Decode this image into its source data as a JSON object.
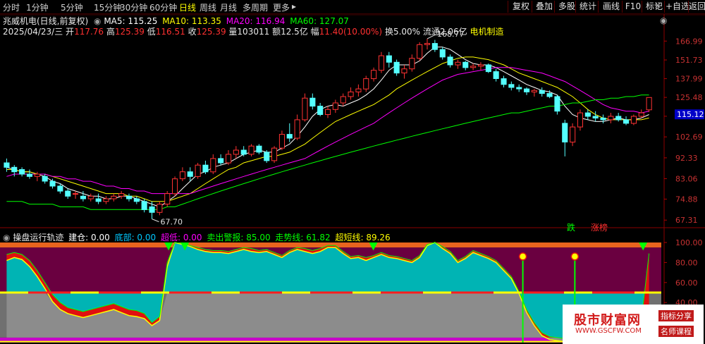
{
  "toolbar": {
    "periods": [
      "分时",
      "1分钟",
      "5分钟",
      "15分钟",
      "30分钟",
      "60分钟",
      "日线",
      "周线",
      "月线",
      "多周期",
      "更多"
    ],
    "active": "日线",
    "more_arrow": "▸",
    "buttons": [
      "复权",
      "叠加",
      "多股",
      "统计",
      "画线",
      "F10",
      "标记",
      "+自选",
      "返回"
    ],
    "close_icon": "close-icon"
  },
  "header": {
    "title": "兆威机电(日线,前复权)",
    "ma": [
      {
        "label": "MA5: 115.25",
        "color": "#ffffff"
      },
      {
        "label": "MA10: 113.35",
        "color": "#ffff00"
      },
      {
        "label": "MA20: 116.94",
        "color": "#ff00ff"
      },
      {
        "label": "MA60: 127.07",
        "color": "#00ff00"
      }
    ],
    "ohlc": {
      "date": "2025/04/23/三",
      "open_label": "开",
      "open": "117.76",
      "high_label": "高",
      "high": "125.39",
      "low_label": "低",
      "low": "116.51",
      "close_label": "收",
      "close": "125.39",
      "vol": "量103011",
      "amt": "额12.5亿",
      "chg_label": "幅",
      "chg": "11.40(10.00%)",
      "turn": "换5.00%",
      "float": "流通2.06亿",
      "industry": "电机制造"
    },
    "side_icon": "gear-icon"
  },
  "price_axis": {
    "ticks": [
      "166.99",
      "151.73",
      "137.99",
      "125.48",
      "114.02",
      "102.69",
      "92.33",
      "83.06",
      "74.88",
      "67.31"
    ],
    "current": "115.12",
    "annotations": {
      "high": "168.77",
      "low": "67.70"
    }
  },
  "chart_data": {
    "type": "candlestick",
    "ylim": [
      65,
      172
    ],
    "candles": [
      [
        90,
        92,
        86,
        88
      ],
      [
        88,
        89,
        84,
        86
      ],
      [
        87,
        88,
        84,
        85
      ],
      [
        85,
        87,
        83,
        84
      ],
      [
        84,
        86,
        82,
        85
      ],
      [
        84,
        85,
        81,
        82
      ],
      [
        82,
        83,
        79,
        80
      ],
      [
        80,
        81,
        77,
        78
      ],
      [
        78,
        79,
        75,
        76
      ],
      [
        77,
        78,
        75,
        77
      ],
      [
        76,
        78,
        74,
        75
      ],
      [
        75,
        77,
        74,
        76
      ],
      [
        75,
        77,
        73,
        74
      ],
      [
        74,
        76,
        73,
        75
      ],
      [
        75,
        77,
        74,
        76
      ],
      [
        76,
        78,
        75,
        77
      ],
      [
        76,
        77,
        74,
        75
      ],
      [
        75,
        76,
        73,
        74
      ],
      [
        74,
        75,
        70,
        71
      ],
      [
        72,
        74,
        67.7,
        70
      ],
      [
        70,
        74,
        69,
        73
      ],
      [
        73,
        78,
        72,
        77
      ],
      [
        77,
        84,
        76,
        83
      ],
      [
        83,
        88,
        82,
        86
      ],
      [
        86,
        88,
        82,
        84
      ],
      [
        84,
        90,
        83,
        89
      ],
      [
        89,
        91,
        85,
        86
      ],
      [
        86,
        94,
        85,
        92
      ],
      [
        92,
        94,
        89,
        90
      ],
      [
        90,
        96,
        89,
        94
      ],
      [
        94,
        98,
        92,
        96
      ],
      [
        96,
        98,
        93,
        94
      ],
      [
        94,
        99,
        93,
        98
      ],
      [
        98,
        99,
        94,
        95
      ],
      [
        95,
        96,
        90,
        91
      ],
      [
        91,
        98,
        90,
        97
      ],
      [
        97,
        106,
        96,
        104
      ],
      [
        104,
        110,
        100,
        102
      ],
      [
        102,
        115,
        101,
        112
      ],
      [
        112,
        128,
        111,
        125
      ],
      [
        125,
        128,
        118,
        120
      ],
      [
        120,
        122,
        114,
        115
      ],
      [
        115,
        120,
        113,
        118
      ],
      [
        118,
        124,
        116,
        122
      ],
      [
        122,
        128,
        120,
        126
      ],
      [
        126,
        132,
        124,
        129
      ],
      [
        129,
        134,
        126,
        131
      ],
      [
        131,
        140,
        129,
        138
      ],
      [
        138,
        146,
        136,
        144
      ],
      [
        144,
        158,
        142,
        155
      ],
      [
        155,
        158,
        146,
        150
      ],
      [
        150,
        152,
        140,
        142
      ],
      [
        142,
        148,
        138,
        145
      ],
      [
        145,
        156,
        143,
        153
      ],
      [
        153,
        166,
        151,
        164
      ],
      [
        164,
        169,
        160,
        165
      ],
      [
        165,
        168,
        158,
        160
      ],
      [
        160,
        162,
        152,
        154
      ],
      [
        154,
        156,
        146,
        148
      ],
      [
        148,
        152,
        145,
        150
      ],
      [
        150,
        151,
        144,
        146
      ],
      [
        146,
        149,
        144,
        147
      ],
      [
        147,
        150,
        144,
        148
      ],
      [
        148,
        149,
        142,
        143
      ],
      [
        143,
        145,
        136,
        138
      ],
      [
        138,
        140,
        132,
        134
      ],
      [
        134,
        136,
        130,
        132
      ],
      [
        132,
        134,
        129,
        131
      ],
      [
        131,
        132,
        127,
        129
      ],
      [
        129,
        131,
        126,
        130
      ],
      [
        130,
        132,
        126,
        128
      ],
      [
        128,
        130,
        125,
        126
      ],
      [
        126,
        127,
        115,
        117
      ],
      [
        110,
        112,
        93,
        100
      ],
      [
        100,
        110,
        98,
        108
      ],
      [
        108,
        118,
        106,
        116
      ],
      [
        116,
        118,
        112,
        114
      ],
      [
        114,
        117,
        111,
        113
      ],
      [
        113,
        115,
        110,
        112
      ],
      [
        112,
        116,
        110,
        114
      ],
      [
        114,
        116,
        111,
        112
      ],
      [
        112,
        114,
        109,
        110
      ],
      [
        110,
        115,
        109,
        114
      ],
      [
        114,
        118,
        113,
        116
      ],
      [
        117.76,
        125.39,
        116.51,
        125.39
      ]
    ],
    "ma_lines": [
      {
        "name": "MA5",
        "color": "#ffffff",
        "values": [
          88,
          87,
          86,
          86,
          85,
          84,
          82,
          81,
          79,
          78,
          77,
          76,
          76,
          75,
          75,
          76,
          76,
          75,
          74,
          73,
          72,
          74,
          76,
          79,
          82,
          85,
          86,
          88,
          89,
          90,
          92,
          94,
          95,
          96,
          95,
          95,
          97,
          99,
          103,
          108,
          114,
          118,
          120,
          121,
          120,
          122,
          124,
          127,
          131,
          137,
          144,
          148,
          148,
          148,
          151,
          157,
          162,
          162,
          160,
          156,
          152,
          149,
          148,
          148,
          146,
          143,
          140,
          137,
          134,
          132,
          130,
          129,
          127,
          120,
          115,
          113,
          112,
          111,
          111,
          112,
          113,
          112,
          112,
          113,
          115
        ]
      },
      {
        "name": "MA10",
        "color": "#ffff00",
        "values": [
          87,
          87,
          86,
          86,
          85,
          85,
          84,
          83,
          82,
          81,
          80,
          79,
          78,
          77,
          77,
          77,
          76,
          76,
          75,
          74,
          74,
          74,
          75,
          76,
          77,
          79,
          81,
          83,
          85,
          87,
          88,
          90,
          91,
          92,
          93,
          93,
          94,
          95,
          97,
          99,
          102,
          105,
          108,
          111,
          113,
          115,
          117,
          119,
          121,
          124,
          127,
          131,
          134,
          137,
          140,
          143,
          146,
          149,
          151,
          153,
          154,
          154,
          153,
          152,
          150,
          148,
          145,
          142,
          140,
          138,
          136,
          134,
          132,
          129,
          126,
          122,
          118,
          115,
          113,
          112,
          112,
          112,
          112,
          112,
          113
        ]
      },
      {
        "name": "MA20",
        "color": "#ff00ff",
        "values": [
          84,
          85,
          85,
          85,
          85,
          85,
          84,
          84,
          83,
          83,
          82,
          82,
          81,
          80,
          80,
          79,
          79,
          78,
          78,
          77,
          77,
          77,
          77,
          77,
          77,
          78,
          79,
          80,
          81,
          82,
          83,
          84,
          85,
          86,
          87,
          88,
          89,
          90,
          91,
          92,
          94,
          96,
          98,
          100,
          102,
          104,
          106,
          108,
          110,
          113,
          116,
          119,
          122,
          125,
          128,
          131,
          134,
          137,
          139,
          141,
          142,
          143,
          144,
          145,
          146,
          146,
          146,
          145,
          144,
          143,
          142,
          140,
          138,
          136,
          133,
          130,
          127,
          124,
          121,
          119,
          118,
          117,
          117,
          116,
          117
        ]
      },
      {
        "name": "MA60",
        "color": "#00ff00",
        "values": [
          74,
          74,
          74,
          73,
          73,
          73,
          73,
          72,
          72,
          72,
          72,
          71,
          71,
          71,
          71,
          71,
          71,
          71,
          71,
          71,
          71,
          72,
          72,
          73,
          74,
          75,
          76,
          77,
          78,
          79,
          80,
          81,
          82,
          83,
          84,
          85,
          86,
          87,
          88,
          89,
          90,
          91,
          92,
          93,
          94,
          95,
          96,
          97,
          98,
          99,
          100,
          101,
          102,
          103,
          104,
          105,
          106,
          107,
          108,
          109,
          110,
          111,
          112,
          113,
          114,
          115,
          116,
          116,
          117,
          118,
          119,
          120,
          120,
          121,
          122,
          122,
          123,
          124,
          124,
          125,
          125,
          126,
          126,
          127,
          127
        ]
      }
    ],
    "labels": [
      {
        "text": "跌",
        "color": "#00ff00"
      },
      {
        "text": "涨榜",
        "color": "#ff3030"
      }
    ]
  },
  "sub": {
    "title": "操盘运行轨迹",
    "items": [
      {
        "label": "建仓: 0.00",
        "color": "#ffffff"
      },
      {
        "label": "底部: 0.00",
        "color": "#00c8ff"
      },
      {
        "label": "超低: 0.00",
        "color": "#ff00ff"
      },
      {
        "label": "卖出警报: 85.00",
        "color": "#00ff00"
      },
      {
        "label": "走势线: 61.82",
        "color": "#00ff00"
      },
      {
        "label": "超短线: 89.26",
        "color": "#ffff00"
      }
    ],
    "ticks": [
      "100.00",
      "80.00",
      "60.00",
      "40.00",
      "20.00"
    ],
    "ylim": [
      0,
      100
    ],
    "trend": [
      82,
      85,
      83,
      76,
      66,
      54,
      41,
      33,
      29,
      27,
      25,
      27,
      29,
      31,
      33,
      30,
      27,
      26,
      24,
      17,
      22,
      76,
      100,
      98,
      96,
      93,
      91,
      90,
      90,
      89,
      91,
      93,
      91,
      90,
      91,
      88,
      85,
      90,
      93,
      91,
      89,
      91,
      95,
      95,
      89,
      84,
      85,
      82,
      85,
      88,
      85,
      84,
      82,
      80,
      85,
      97,
      100,
      94,
      89,
      80,
      84,
      90,
      87,
      84,
      80,
      72,
      64,
      49,
      30,
      17,
      7,
      3,
      2,
      1,
      3,
      5,
      4,
      3,
      2,
      2,
      1,
      3,
      5,
      8,
      11
    ],
    "short": [
      88,
      90,
      88,
      82,
      72,
      60,
      48,
      40,
      35,
      33,
      31,
      33,
      35,
      37,
      39,
      36,
      33,
      32,
      29,
      20,
      26,
      80,
      100,
      99,
      97,
      95,
      93,
      92,
      92,
      91,
      93,
      95,
      94,
      92,
      93,
      90,
      87,
      92,
      95,
      94,
      92,
      94,
      97,
      97,
      91,
      86,
      87,
      85,
      87,
      90,
      87,
      86,
      84,
      82,
      87,
      98,
      100,
      96,
      91,
      82,
      86,
      92,
      89,
      86,
      82,
      74,
      66,
      51,
      33,
      20,
      10,
      6,
      5,
      4,
      8,
      11,
      9,
      8,
      7,
      8,
      6,
      9,
      13,
      22,
      89
    ]
  },
  "watermark": {
    "logo": "股市财富网",
    "url": "WWW.GSCFW.COM",
    "tag1": "指标分享",
    "tag2": "名师课程"
  }
}
